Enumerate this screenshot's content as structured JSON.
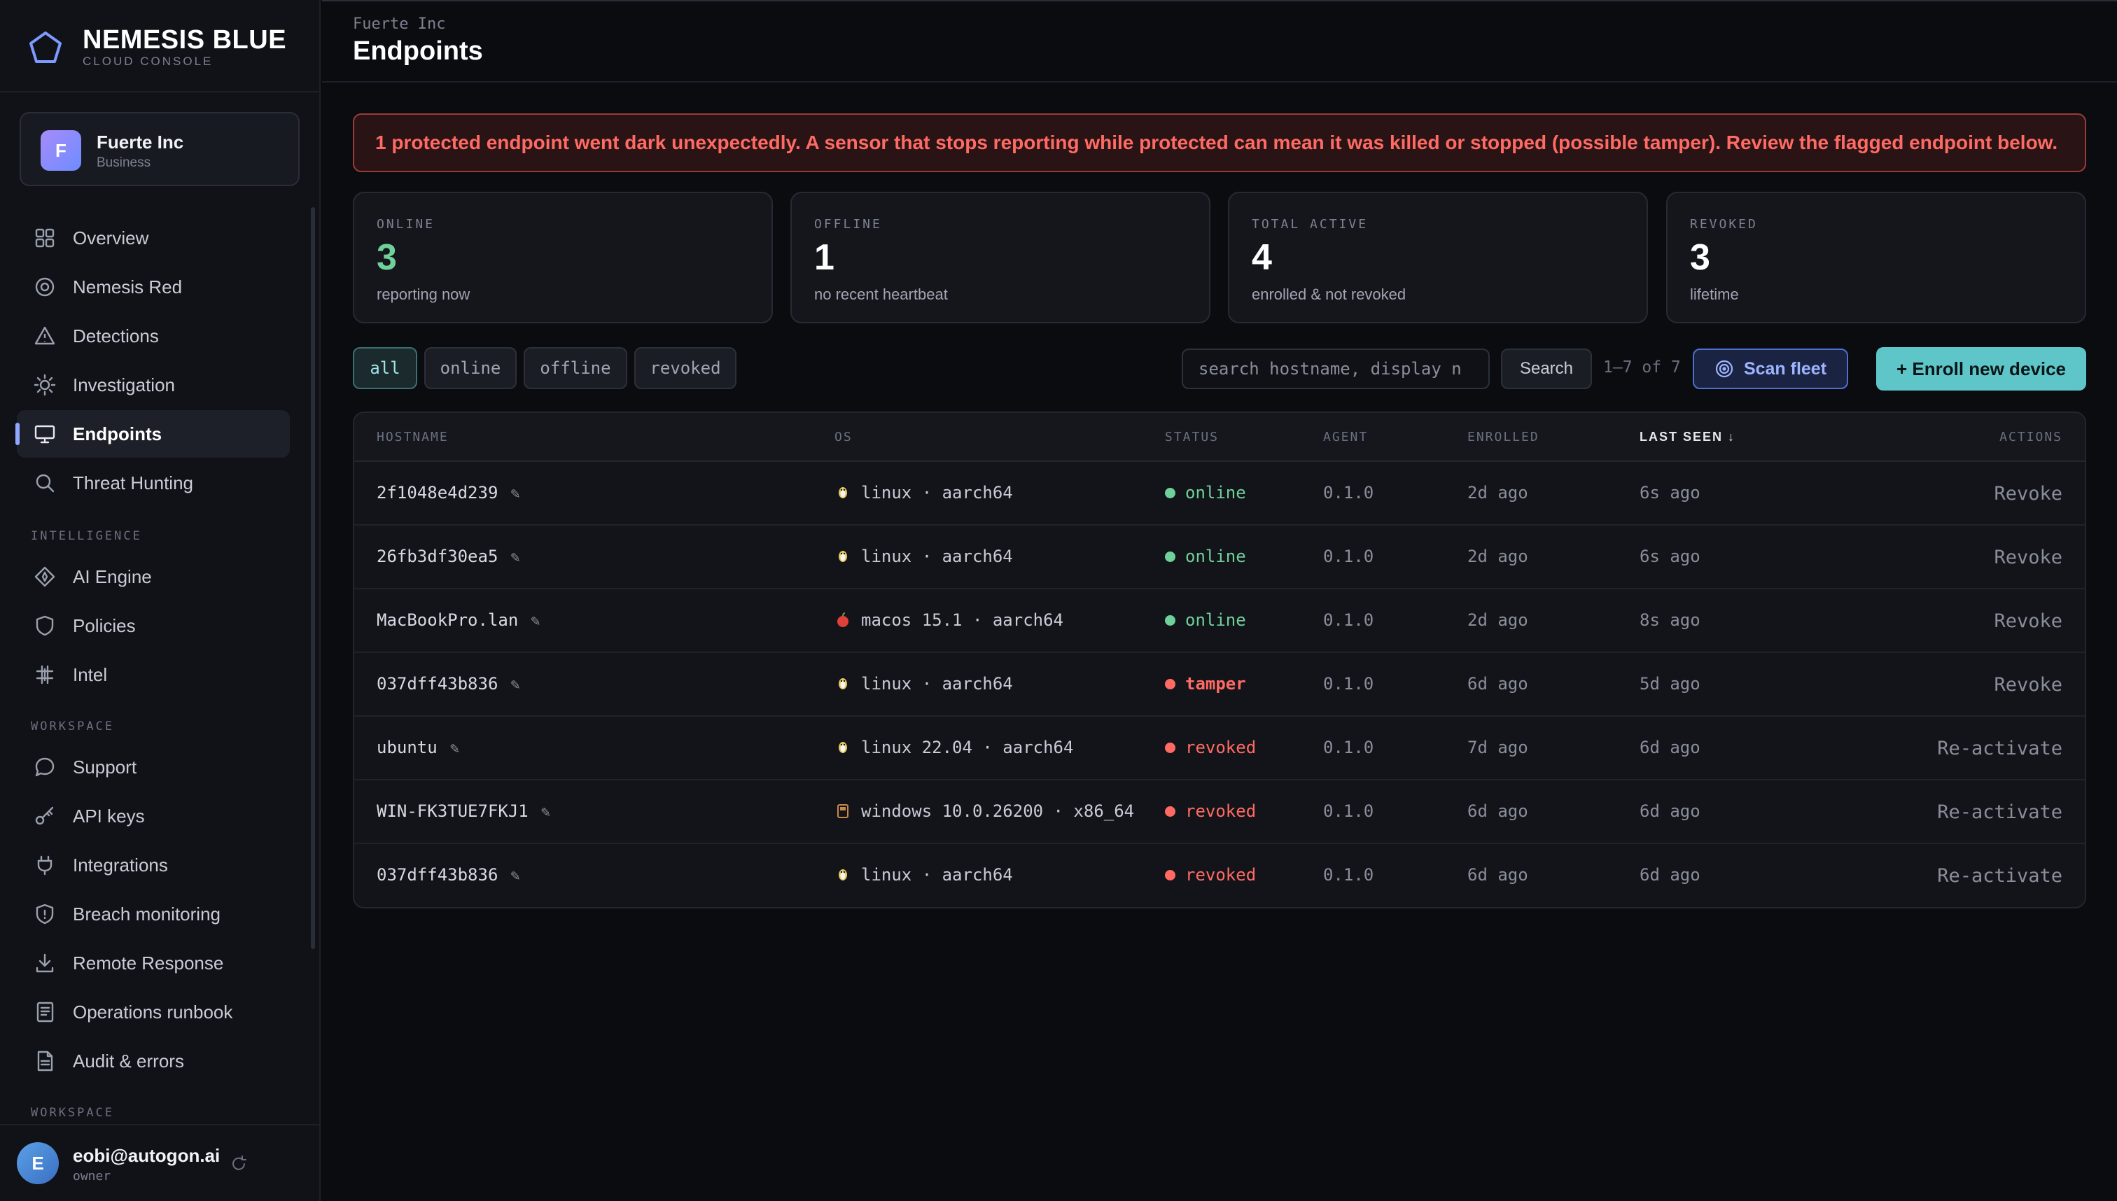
{
  "brand": {
    "name": "NEMESIS BLUE",
    "subtitle": "CLOUD CONSOLE"
  },
  "org": {
    "initial": "F",
    "name": "Fuerte Inc",
    "plan": "Business"
  },
  "nav": {
    "items": [
      {
        "label": "Overview",
        "icon": "grid-icon"
      },
      {
        "label": "Nemesis Red",
        "icon": "target-icon"
      },
      {
        "label": "Detections",
        "icon": "warning-icon"
      },
      {
        "label": "Investigation",
        "icon": "sun-icon"
      },
      {
        "label": "Endpoints",
        "icon": "monitor-icon",
        "active": true
      },
      {
        "label": "Threat Hunting",
        "icon": "search-icon"
      }
    ],
    "section_intelligence": "INTELLIGENCE",
    "intelligence_items": [
      {
        "label": "AI Engine",
        "icon": "sparkle-icon"
      },
      {
        "label": "Policies",
        "icon": "shield-icon"
      },
      {
        "label": "Intel",
        "icon": "hash-icon"
      }
    ],
    "section_workspace": "WORKSPACE",
    "workspace_items": [
      {
        "label": "Support",
        "icon": "chat-icon"
      },
      {
        "label": "API keys",
        "icon": "key-icon"
      },
      {
        "label": "Integrations",
        "icon": "plug-icon"
      },
      {
        "label": "Breach monitoring",
        "icon": "shield-alert-icon"
      },
      {
        "label": "Remote Response",
        "icon": "download-icon"
      },
      {
        "label": "Operations runbook",
        "icon": "book-icon"
      },
      {
        "label": "Audit & errors",
        "icon": "file-icon"
      }
    ],
    "section_workspace_2": "WORKSPACE"
  },
  "user": {
    "initial": "E",
    "email": "eobi@autogon.ai",
    "role": "owner"
  },
  "header": {
    "breadcrumb": "Fuerte Inc",
    "title": "Endpoints"
  },
  "alert": {
    "text": "1 protected endpoint went dark unexpectedly. A sensor that stops reporting while protected can mean it was killed or stopped (possible tamper). Review the flagged endpoint below."
  },
  "stats": [
    {
      "label": "ONLINE",
      "value": "3",
      "sub": "reporting now"
    },
    {
      "label": "OFFLINE",
      "value": "1",
      "sub": "no recent heartbeat"
    },
    {
      "label": "TOTAL ACTIVE",
      "value": "4",
      "sub": "enrolled & not revoked"
    },
    {
      "label": "REVOKED",
      "value": "3",
      "sub": "lifetime"
    }
  ],
  "filters": [
    "all",
    "online",
    "offline",
    "revoked"
  ],
  "search": {
    "placeholder": "search hostname, display n",
    "button": "Search"
  },
  "pager": "1–7 of 7",
  "scan_button": "Scan fleet",
  "enroll_button": "+ Enroll new device",
  "table": {
    "columns": {
      "hostname": "HOSTNAME",
      "os": "OS",
      "status": "STATUS",
      "agent": "AGENT",
      "enrolled": "ENROLLED",
      "last_seen": "LAST SEEN ↓",
      "actions": "ACTIONS"
    },
    "rows": [
      {
        "hostname": "2f1048e4d239",
        "os": "linux · aarch64",
        "os_icon": "linux-icon",
        "status": "online",
        "agent": "0.1.0",
        "enrolled": "2d ago",
        "last_seen": "6s ago",
        "action": "Revoke"
      },
      {
        "hostname": "26fb3df30ea5",
        "os": "linux · aarch64",
        "os_icon": "linux-icon",
        "status": "online",
        "agent": "0.1.0",
        "enrolled": "2d ago",
        "last_seen": "6s ago",
        "action": "Revoke"
      },
      {
        "hostname": "MacBookPro.lan",
        "os": "macos 15.1 · aarch64",
        "os_icon": "apple-icon",
        "status": "online",
        "agent": "0.1.0",
        "enrolled": "2d ago",
        "last_seen": "8s ago",
        "action": "Revoke"
      },
      {
        "hostname": "037dff43b836",
        "os": "linux · aarch64",
        "os_icon": "linux-icon",
        "status": "tamper",
        "agent": "0.1.0",
        "enrolled": "6d ago",
        "last_seen": "5d ago",
        "action": "Revoke"
      },
      {
        "hostname": "ubuntu",
        "os": "linux 22.04 · aarch64",
        "os_icon": "linux-icon",
        "status": "revoked",
        "agent": "0.1.0",
        "enrolled": "7d ago",
        "last_seen": "6d ago",
        "action": "Re-activate"
      },
      {
        "hostname": "WIN-FK3TUE7FKJ1",
        "os": "windows 10.0.26200 · x86_64",
        "os_icon": "windows-icon",
        "status": "revoked",
        "agent": "0.1.0",
        "enrolled": "6d ago",
        "last_seen": "6d ago",
        "action": "Re-activate"
      },
      {
        "hostname": "037dff43b836",
        "os": "linux · aarch64",
        "os_icon": "linux-icon",
        "status": "revoked",
        "agent": "0.1.0",
        "enrolled": "6d ago",
        "last_seen": "6d ago",
        "action": "Re-activate"
      }
    ]
  },
  "colors": {
    "accent": "#5ec6c8",
    "online": "#6fd19a",
    "danger": "#ff6b64",
    "scan": "#4f6fd1",
    "background": "#0b0c10"
  }
}
